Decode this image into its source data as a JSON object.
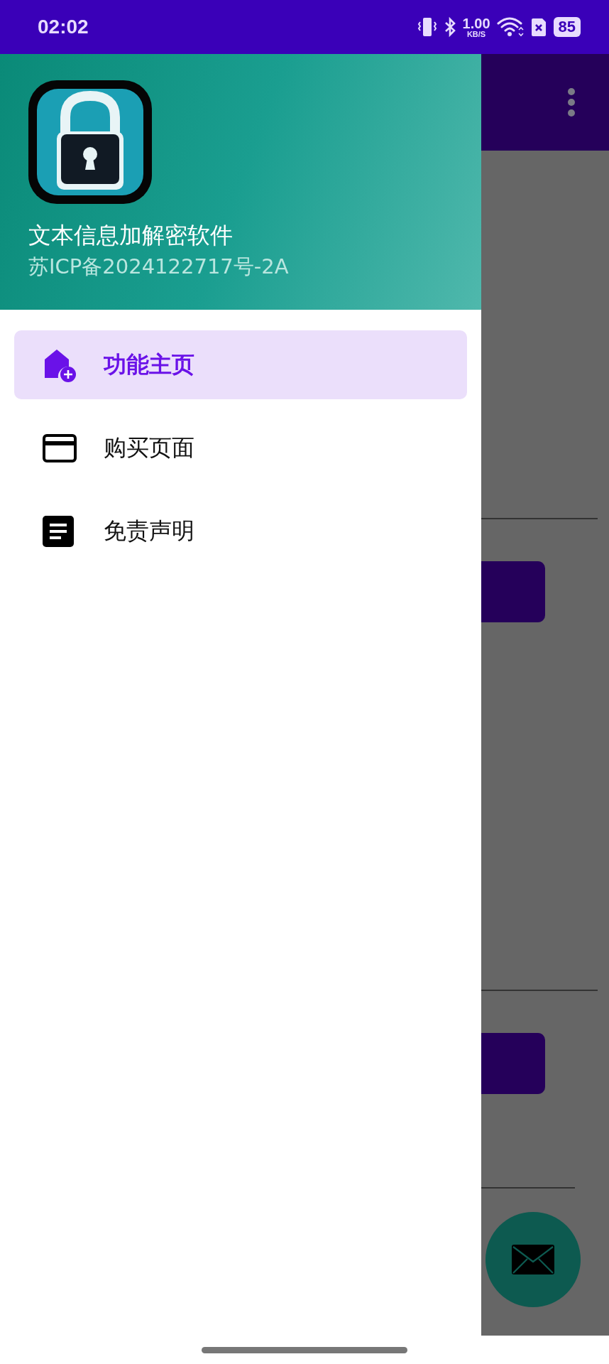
{
  "status_bar": {
    "time": "02:02",
    "net_speed": "1.00",
    "net_unit": "KB/S",
    "battery": "85"
  },
  "drawer": {
    "title": "文本信息加解密软件",
    "subtitle": "苏ICP备2024122717号-2A",
    "items": [
      {
        "label": "功能主页",
        "selected": true
      },
      {
        "label": "购买页面",
        "selected": false
      },
      {
        "label": "免责声明",
        "selected": false
      }
    ]
  }
}
